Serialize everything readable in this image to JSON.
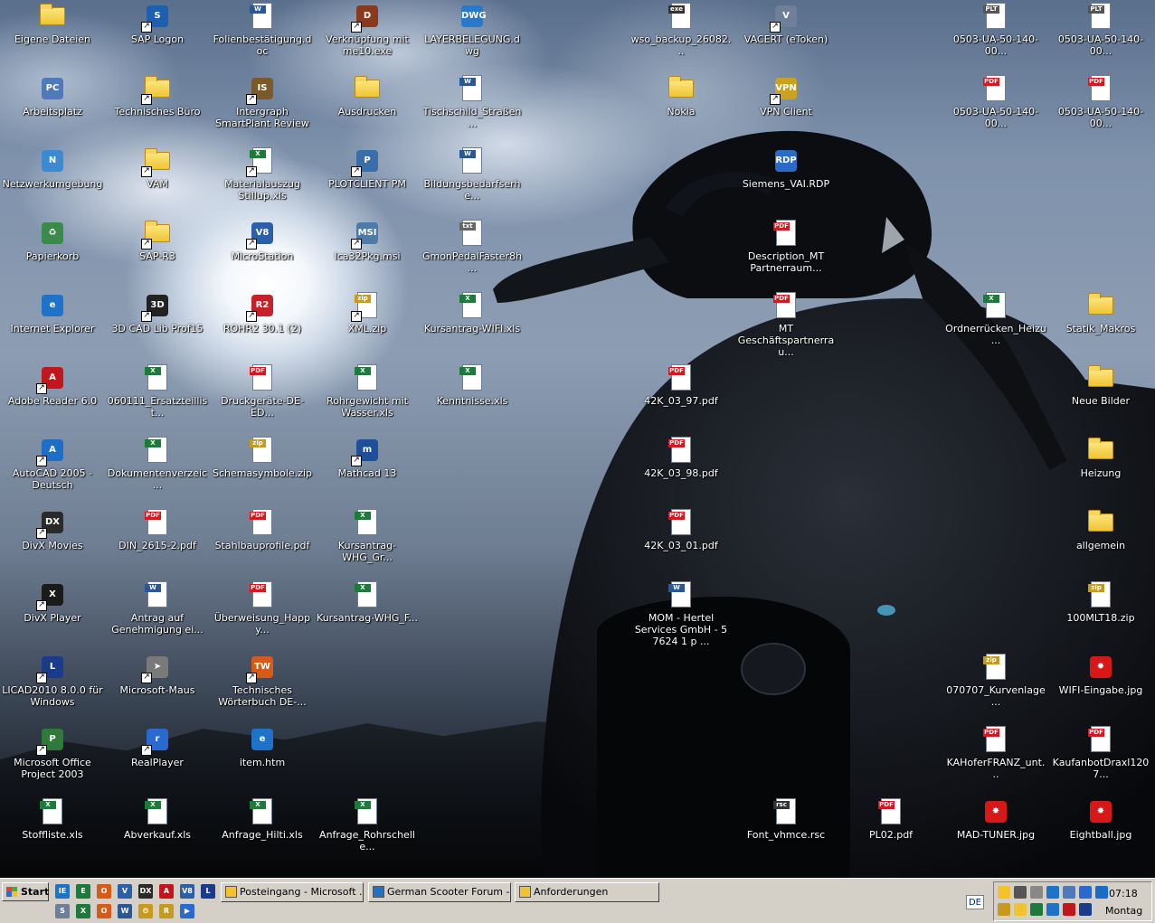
{
  "desktop": {
    "icons": [
      {
        "label": "Eigene Dateien",
        "type": "folder"
      },
      {
        "label": "SAP Logon",
        "type": "app",
        "color": "#1f5fb0",
        "glyph": "S",
        "shortcut": true
      },
      {
        "label": "Folienbestätigung.doc",
        "type": "doc",
        "tag": "W",
        "color": "#2b5797"
      },
      {
        "label": "Verknüpfung mit me10.exe",
        "type": "app",
        "color": "#8a3a1c",
        "glyph": "D",
        "shortcut": true
      },
      {
        "label": "LAYERBELEGUNG.dwg",
        "type": "app",
        "color": "#2a79c8",
        "glyph": "DWG"
      },
      {
        "label": "wso_backup_26082...",
        "type": "doc",
        "tag": "exe",
        "color": "#333"
      },
      {
        "label": "VACERT (eToken)",
        "type": "app",
        "color": "#6f7f9a",
        "glyph": "V",
        "shortcut": true
      },
      {
        "label": "0503-UA-50-140-00...",
        "type": "doc",
        "tag": "PLT",
        "color": "#555"
      },
      {
        "label": "0503-UA-50-140-00...",
        "type": "doc",
        "tag": "PLT",
        "color": "#555"
      },
      {
        "label": "Arbeitsplatz",
        "type": "app",
        "color": "#4f79b8",
        "glyph": "PC"
      },
      {
        "label": "Technisches Büro",
        "type": "folder",
        "shortcut": true
      },
      {
        "label": "Intergraph SmartPlant Review",
        "type": "app",
        "color": "#7a5a2a",
        "glyph": "IS",
        "shortcut": true
      },
      {
        "label": "Ausdrucken",
        "type": "folder"
      },
      {
        "label": "Tischschild_Straßen...",
        "type": "doc",
        "tag": "W",
        "color": "#2b5797"
      },
      {
        "label": "Nokia",
        "type": "folder"
      },
      {
        "label": "VPN Client",
        "type": "app",
        "color": "#c9a320",
        "glyph": "VPN",
        "shortcut": true
      },
      {
        "label": "0503-UA-50-140-00...",
        "type": "doc",
        "tag": "PDF",
        "color": "#d4191c"
      },
      {
        "label": "0503-UA-50-140-00...",
        "type": "doc",
        "tag": "PDF",
        "color": "#d4191c"
      },
      {
        "label": "Netzwerkumgebung",
        "type": "app",
        "color": "#3c8ad0",
        "glyph": "N"
      },
      {
        "label": "VAM",
        "type": "folder",
        "shortcut": true
      },
      {
        "label": "Materialauszug Stillup.xls",
        "type": "doc",
        "tag": "X",
        "color": "#1d7a3a",
        "shortcut": true
      },
      {
        "label": "PLOTCLIENT PM",
        "type": "app",
        "color": "#3a6ea8",
        "glyph": "P",
        "shortcut": true
      },
      {
        "label": "Bildungsbedarfserhe...",
        "type": "doc",
        "tag": "W",
        "color": "#2b5797"
      },
      {
        "label": "Siemens_VAI.RDP",
        "type": "app",
        "color": "#2a6bc8",
        "glyph": "RDP"
      },
      {
        "label": "Papierkorb",
        "type": "app",
        "color": "#3a8a4a",
        "glyph": "♻"
      },
      {
        "label": "SAP-R3",
        "type": "folder",
        "shortcut": true
      },
      {
        "label": "MicroStation",
        "type": "app",
        "color": "#2d5ea8",
        "glyph": "V8",
        "shortcut": true
      },
      {
        "label": "Ica32Pkg.msi",
        "type": "app",
        "color": "#4d7aa8",
        "glyph": "MSI",
        "shortcut": true
      },
      {
        "label": "GmonPedalFaster8h...",
        "type": "doc",
        "tag": "txt",
        "color": "#666"
      },
      {
        "label": "Description_MT Partnerraum...",
        "type": "doc",
        "tag": "PDF",
        "color": "#d4191c"
      },
      {
        "label": "Internet Explorer",
        "type": "app",
        "color": "#1e73c8",
        "glyph": "e"
      },
      {
        "label": "3D CAD Lib Prof15",
        "type": "app",
        "color": "#222",
        "glyph": "3D",
        "shortcut": true
      },
      {
        "label": "ROHR2 30.1 (2)",
        "type": "app",
        "color": "#c8202a",
        "glyph": "R2",
        "shortcut": true
      },
      {
        "label": "XML.zip",
        "type": "doc",
        "tag": "zip",
        "color": "#c79a1f",
        "shortcut": true
      },
      {
        "label": "Kursantrag-WIFI.xls",
        "type": "doc",
        "tag": "X",
        "color": "#1d7a3a"
      },
      {
        "label": "MT Geschäftspartnerrau...",
        "type": "doc",
        "tag": "PDF",
        "color": "#d4191c"
      },
      {
        "label": "Ordnerrücken_Heizu...",
        "type": "doc",
        "tag": "X",
        "color": "#1d7a3a"
      },
      {
        "label": "Statik_Makros",
        "type": "folder"
      },
      {
        "label": "Adobe Reader 6.0",
        "type": "app",
        "color": "#c0161c",
        "glyph": "A",
        "shortcut": true
      },
      {
        "label": "060111_Ersatzteillist...",
        "type": "doc",
        "tag": "X",
        "color": "#1d7a3a"
      },
      {
        "label": "Druckgeräte-DE-ED...",
        "type": "doc",
        "tag": "PDF",
        "color": "#d4191c"
      },
      {
        "label": "Rohrgewicht mit Wasser.xls",
        "type": "doc",
        "tag": "X",
        "color": "#1d7a3a"
      },
      {
        "label": "Kenntnisse.xls",
        "type": "doc",
        "tag": "X",
        "color": "#1d7a3a"
      },
      {
        "label": "42K_03_97.pdf",
        "type": "doc",
        "tag": "PDF",
        "color": "#d4191c"
      },
      {
        "label": "Neue Bilder",
        "type": "folder"
      },
      {
        "label": "AutoCAD 2005 - Deutsch",
        "type": "app",
        "color": "#1e6ec8",
        "glyph": "A",
        "shortcut": true
      },
      {
        "label": "Dokumentenverzeic...",
        "type": "doc",
        "tag": "X",
        "color": "#1d7a3a"
      },
      {
        "label": "Schemasymbole.zip",
        "type": "doc",
        "tag": "zip",
        "color": "#c79a1f"
      },
      {
        "label": "Mathcad 13",
        "type": "app",
        "color": "#1e4f9a",
        "glyph": "m",
        "shortcut": true
      },
      {
        "label": "42K_03_98.pdf",
        "type": "doc",
        "tag": "PDF",
        "color": "#d4191c"
      },
      {
        "label": "Heizung",
        "type": "folder"
      },
      {
        "label": "DivX Movies",
        "type": "app",
        "color": "#2a2a2a",
        "glyph": "DX",
        "shortcut": true
      },
      {
        "label": "DIN_2615-2.pdf",
        "type": "doc",
        "tag": "PDF",
        "color": "#d4191c"
      },
      {
        "label": "Stahlbauprofile.pdf",
        "type": "doc",
        "tag": "PDF",
        "color": "#d4191c"
      },
      {
        "label": "Kursantrag-WHG_Gr...",
        "type": "doc",
        "tag": "X",
        "color": "#1d7a3a"
      },
      {
        "label": "42K_03_01.pdf",
        "type": "doc",
        "tag": "PDF",
        "color": "#d4191c"
      },
      {
        "label": "allgemein",
        "type": "folder"
      },
      {
        "label": "DivX Player",
        "type": "app",
        "color": "#1a1a1a",
        "glyph": "X",
        "shortcut": true
      },
      {
        "label": "Antrag auf Genehmigung ei...",
        "type": "doc",
        "tag": "W",
        "color": "#2b5797"
      },
      {
        "label": "Überweisung_Happy...",
        "type": "doc",
        "tag": "PDF",
        "color": "#d4191c"
      },
      {
        "label": "Kursantrag-WHG_F...",
        "type": "doc",
        "tag": "X",
        "color": "#1d7a3a"
      },
      {
        "label": "MOM - Hertel Services GmbH - 5 7624 1 p ...",
        "type": "doc",
        "tag": "W",
        "color": "#2b5797"
      },
      {
        "label": "100MLT18.zip",
        "type": "doc",
        "tag": "zip",
        "color": "#c79a1f"
      },
      {
        "label": "LICAD2010 8.0.0 für Windows",
        "type": "app",
        "color": "#1a3a8a",
        "glyph": "L",
        "shortcut": true
      },
      {
        "label": "Microsoft-Maus",
        "type": "app",
        "color": "#7a7a7a",
        "glyph": "➤",
        "shortcut": true
      },
      {
        "label": "Technisches Wörterbuch DE-...",
        "type": "app",
        "color": "#d85a18",
        "glyph": "TW",
        "shortcut": true
      },
      {
        "label": "070707_Kurvenlage...",
        "type": "doc",
        "tag": "zip",
        "color": "#c79a1f"
      },
      {
        "label": "WIFI-Eingabe.jpg",
        "type": "app",
        "color": "#d81818",
        "glyph": "✸"
      },
      {
        "label": "Microsoft Office Project 2003",
        "type": "app",
        "color": "#2f7a3a",
        "glyph": "P",
        "shortcut": true
      },
      {
        "label": "RealPlayer",
        "type": "app",
        "color": "#2a6ad0",
        "glyph": "r",
        "shortcut": true
      },
      {
        "label": "item.htm",
        "type": "app",
        "color": "#1e73c8",
        "glyph": "e"
      },
      {
        "label": "KAHoferFRANZ_unt...",
        "type": "doc",
        "tag": "PDF",
        "color": "#d4191c"
      },
      {
        "label": "KaufanbotDraxl1207...",
        "type": "doc",
        "tag": "PDF",
        "color": "#d4191c"
      },
      {
        "label": "Stoffliste.xls",
        "type": "doc",
        "tag": "X",
        "color": "#1d7a3a"
      },
      {
        "label": "Abverkauf.xls",
        "type": "doc",
        "tag": "X",
        "color": "#1d7a3a"
      },
      {
        "label": "Anfrage_Hilti.xls",
        "type": "doc",
        "tag": "X",
        "color": "#1d7a3a"
      },
      {
        "label": "Anfrage_Rohrschelle...",
        "type": "doc",
        "tag": "X",
        "color": "#1d7a3a"
      },
      {
        "label": "Font_vhmce.rsc",
        "type": "doc",
        "tag": "rsc",
        "color": "#333"
      },
      {
        "label": "PL02.pdf",
        "type": "doc",
        "tag": "PDF",
        "color": "#d4191c"
      },
      {
        "label": "MAD-TUNER.jpg",
        "type": "app",
        "color": "#d81818",
        "glyph": "✸"
      },
      {
        "label": "Eightball.jpg",
        "type": "app",
        "color": "#d81818",
        "glyph": "✸"
      }
    ]
  },
  "taskbar": {
    "start_label": "Start",
    "quick_launch": [
      "IE",
      "E",
      "O",
      "V",
      "DX",
      "A",
      "V8",
      "L",
      "S",
      "X",
      "O",
      "W",
      "⏲",
      "R",
      "▶"
    ],
    "tasks": [
      {
        "label": "Posteingang - Microsoft ..."
      },
      {
        "label": "German Scooter Forum -..."
      },
      {
        "label": "Anforderungen"
      }
    ],
    "language": "DE",
    "clock_time": "07:18",
    "clock_day": "Montag"
  }
}
